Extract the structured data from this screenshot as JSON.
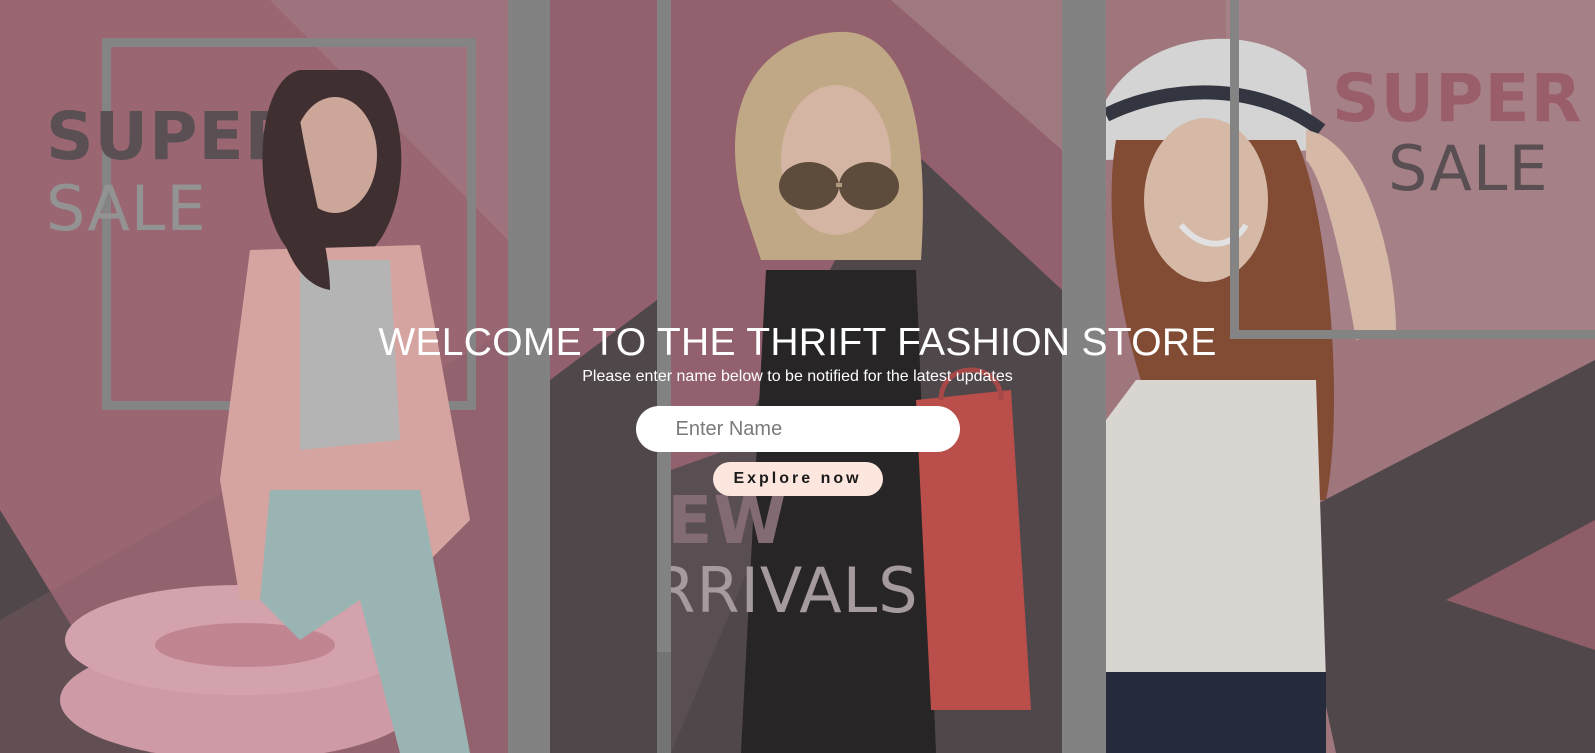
{
  "hero": {
    "title": "WELCOME TO THE THRIFT FASHION STORE",
    "subtitle": "Please enter name below to be notified for the latest updates",
    "name_input_placeholder": "Enter Name",
    "name_input_value": "",
    "explore_button_label": "Explore now"
  },
  "background": {
    "left_panel": {
      "promo_line_1": "SUPER",
      "promo_line_2": "SALE"
    },
    "center_panel": {
      "promo_line_1": "NEW",
      "promo_line_2": "ARRIVALS"
    },
    "right_panel": {
      "promo_line_1": "SUPER",
      "promo_line_2": "SALE"
    }
  },
  "colors": {
    "panel_rose": "#a86a78",
    "panel_dark": "#4f4449",
    "divider_gray": "#8c8c8c",
    "button_peach": "#fde6de",
    "text_white": "#ffffff"
  }
}
